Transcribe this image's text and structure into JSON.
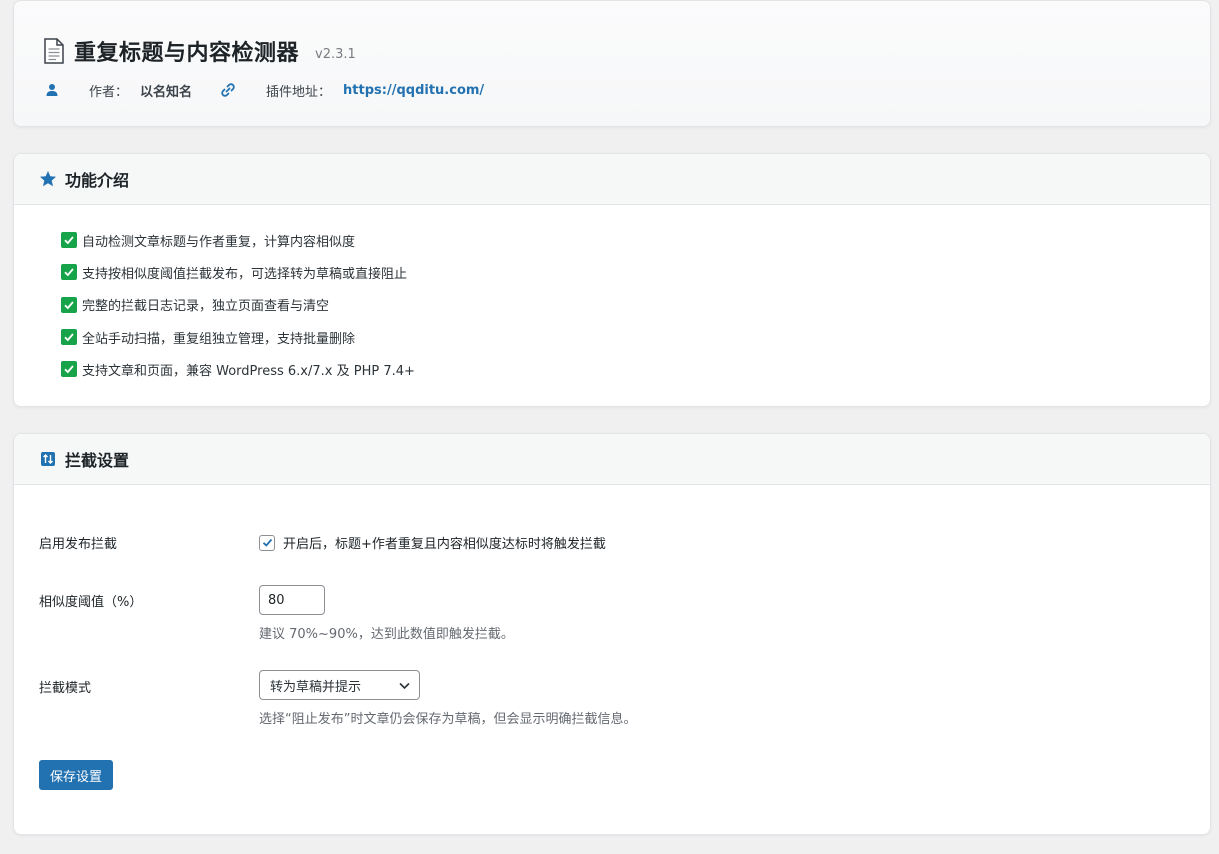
{
  "header": {
    "title": "重复标题与内容检测器",
    "version": "v2.3.1",
    "author_label": "作者：",
    "author_name": "以名知名",
    "site_label": "插件地址：",
    "site_url": "https://qqditu.com/",
    "icons": {
      "title": "document-icon",
      "author": "user-icon",
      "site": "link-icon"
    }
  },
  "features": {
    "title": "功能介绍",
    "icon": "star-icon",
    "items": [
      "自动检测文章标题与作者重复，计算内容相似度",
      "支持按相似度阈值拦截发布，可选择转为草稿或直接阻止",
      "完整的拦截日志记录，独立页面查看与清空",
      "全站手动扫描，重复组独立管理，支持批量删除",
      "支持文章和页面，兼容 WordPress 6.x/7.x 及 PHP 7.4+"
    ]
  },
  "settings": {
    "title": "拦截设置",
    "icon": "sort-icon",
    "enable": {
      "label": "启用发布拦截",
      "checked": true,
      "description": "开启后，标题+作者重复且内容相似度达标时将触发拦截"
    },
    "threshold": {
      "label": "相似度阈值（%）",
      "value": "80",
      "hint": "建议 70%~90%，达到此数值即触发拦截。"
    },
    "mode": {
      "label": "拦截模式",
      "selected": "转为草稿并提示",
      "hint": "选择“阻止发布”时文章仍会保存为草稿，但会显示明确拦截信息。"
    },
    "save_label": "保存设置"
  },
  "colors": {
    "accent": "#2271b1",
    "check_green": "#16a34a",
    "page_bg": "#f0f0f1"
  }
}
